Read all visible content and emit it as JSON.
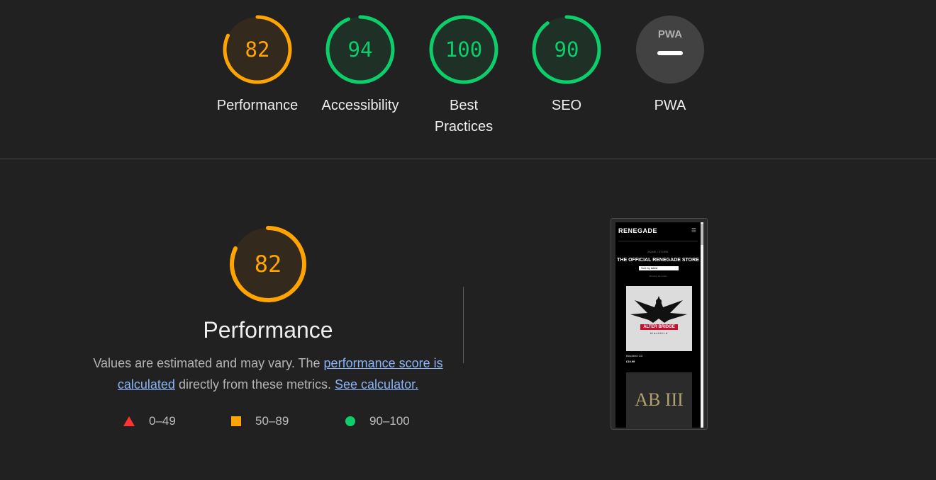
{
  "categories": [
    {
      "score": "82",
      "label": "Performance",
      "value": 82,
      "status": "average"
    },
    {
      "score": "94",
      "label": "Accessibility",
      "value": 94,
      "status": "pass"
    },
    {
      "score": "100",
      "label": "Best Practices",
      "value": 100,
      "status": "pass"
    },
    {
      "score": "90",
      "label": "SEO",
      "value": 90,
      "status": "pass"
    },
    {
      "score": "",
      "label": "PWA",
      "badge": "PWA",
      "status": "na"
    }
  ],
  "performance": {
    "score": "82",
    "value": 82,
    "title": "Performance",
    "desc_prefix": "Values are estimated and may vary. The ",
    "score_link": "performance score is calculated",
    "desc_middle": " directly from these metrics. ",
    "calc_link": "See calculator."
  },
  "legend": [
    {
      "range": "0–49",
      "shape": "triangle",
      "color": "#ff3333"
    },
    {
      "range": "50–89",
      "shape": "square",
      "color": "#ffa400"
    },
    {
      "range": "90–100",
      "shape": "circle",
      "color": "#0cce6b"
    }
  ],
  "screenshot": {
    "logo": "RENEGADE",
    "breadcrumb": "HOME / STORE",
    "title": "THE OFFICIAL RENEGADE STORE",
    "select": "Sort by latest",
    "count": "Showing all results",
    "album1_band": "ALTER BRIDGE",
    "album1_sub": "blackbird",
    "product_name": "Blackbird CD",
    "product_price": "£10.99",
    "album2_mono": "AB III"
  },
  "colors": {
    "pass": "#0cce6b",
    "pass_fill": "#1f3026",
    "average": "#ffa400",
    "average_fill": "#33291c",
    "fail": "#ff3333",
    "na": "#424242",
    "background": "#212121"
  }
}
